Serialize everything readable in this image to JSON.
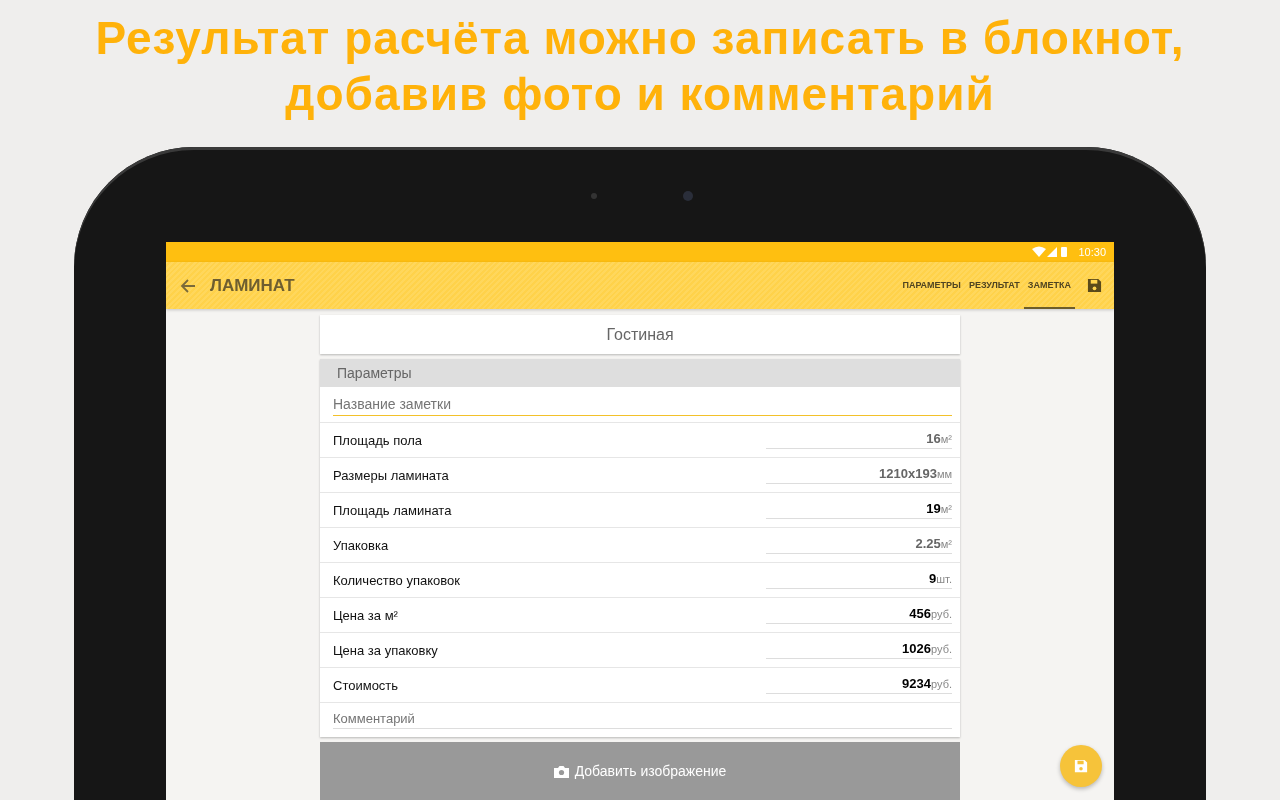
{
  "headline": [
    "Результат расчёта можно записать в блокнот,",
    "добавив фото и комментарий"
  ],
  "status_bar": {
    "time": "10:30"
  },
  "app_bar": {
    "title": "ЛАМИНАТ",
    "tabs": [
      {
        "label": "ПАРАМЕТРЫ",
        "selected": false
      },
      {
        "label": "РЕЗУЛЬТАТ",
        "selected": false
      },
      {
        "label": "ЗАМЕТКА",
        "selected": true
      }
    ]
  },
  "room_title": "Гостиная",
  "section": {
    "title": "Параметры",
    "note_name": {
      "placeholder": "Название заметки"
    },
    "rows": [
      {
        "label": "Площадь пола",
        "value": "16",
        "unit": "м²",
        "bold": false
      },
      {
        "label": "Размеры ламината",
        "value": "1210x193",
        "unit": "мм",
        "bold": false
      },
      {
        "label": "Площадь ламината",
        "value": "19",
        "unit": "м²",
        "bold": true
      },
      {
        "label": "Упаковка",
        "value": "2.25",
        "unit": "м²",
        "bold": false
      },
      {
        "label": "Количество упаковок",
        "value": "9",
        "unit": "шт.",
        "bold": true
      },
      {
        "label": "Цена за м²",
        "value": "456",
        "unit": "руб.",
        "bold": true
      },
      {
        "label": "Цена за упаковку",
        "value": "1026",
        "unit": "руб.",
        "bold": true
      },
      {
        "label": "Стоимость",
        "value": "9234",
        "unit": "руб.",
        "bold": true
      }
    ],
    "comment": {
      "placeholder": "Комментарий"
    }
  },
  "add_image_button": "Добавить изображение"
}
